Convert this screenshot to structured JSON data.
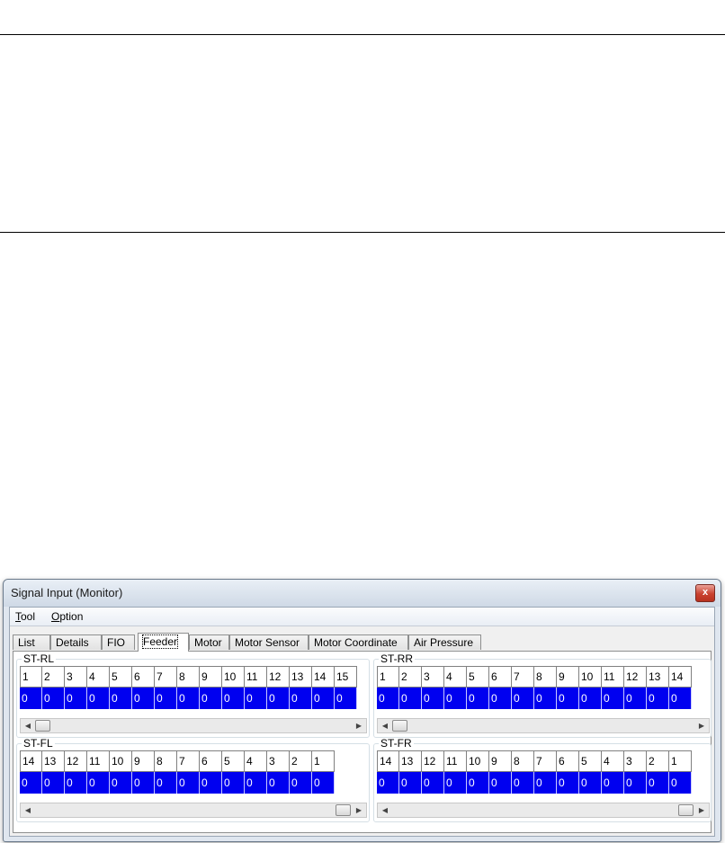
{
  "window": {
    "title": "Signal Input (Monitor)",
    "close_glyph": "x"
  },
  "menu": [
    {
      "label": "Tool",
      "mnemonic": "T",
      "rest": "ool"
    },
    {
      "label": "Option",
      "mnemonic": "O",
      "rest": "ption"
    }
  ],
  "tabs": [
    {
      "label": "List"
    },
    {
      "label": "Details"
    },
    {
      "label": "FIO"
    },
    {
      "label": "Feeder",
      "active": true
    },
    {
      "label": "Motor"
    },
    {
      "label": "Motor Sensor"
    },
    {
      "label": "Motor Coordinate"
    },
    {
      "label": "Air Pressure"
    }
  ],
  "groups": {
    "st_rl": {
      "label": "ST-RL",
      "headers": [
        "1",
        "2",
        "3",
        "4",
        "5",
        "6",
        "7",
        "8",
        "9",
        "10",
        "11",
        "12",
        "13",
        "14",
        "15"
      ],
      "values": [
        "0",
        "0",
        "0",
        "0",
        "0",
        "0",
        "0",
        "0",
        "0",
        "0",
        "0",
        "0",
        "0",
        "0",
        "0"
      ]
    },
    "st_rr": {
      "label": "ST-RR",
      "headers": [
        "1",
        "2",
        "3",
        "4",
        "5",
        "6",
        "7",
        "8",
        "9",
        "10",
        "11",
        "12",
        "13",
        "14"
      ],
      "values": [
        "0",
        "0",
        "0",
        "0",
        "0",
        "0",
        "0",
        "0",
        "0",
        "0",
        "0",
        "0",
        "0",
        "0"
      ]
    },
    "st_fl": {
      "label": "ST-FL",
      "headers": [
        "14",
        "13",
        "12",
        "11",
        "10",
        "9",
        "8",
        "7",
        "6",
        "5",
        "4",
        "3",
        "2",
        "1"
      ],
      "values": [
        "0",
        "0",
        "0",
        "0",
        "0",
        "0",
        "0",
        "0",
        "0",
        "0",
        "0",
        "0",
        "0",
        "0"
      ]
    },
    "st_fr": {
      "label": "ST-FR",
      "headers": [
        "14",
        "13",
        "12",
        "11",
        "10",
        "9",
        "8",
        "7",
        "6",
        "5",
        "4",
        "3",
        "2",
        "1"
      ],
      "values": [
        "0",
        "0",
        "0",
        "0",
        "0",
        "0",
        "0",
        "0",
        "0",
        "0",
        "0",
        "0",
        "0",
        "0"
      ]
    }
  },
  "colors": {
    "value_cell_bg": "#0000f0",
    "value_text": "#ffffff"
  }
}
